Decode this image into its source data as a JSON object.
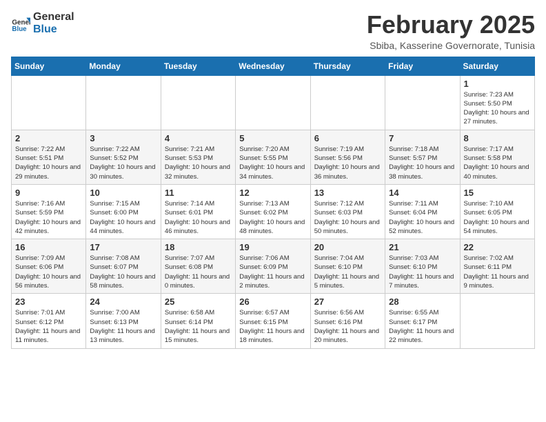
{
  "header": {
    "logo_general": "General",
    "logo_blue": "Blue",
    "month_year": "February 2025",
    "location": "Sbiba, Kasserine Governorate, Tunisia"
  },
  "days_of_week": [
    "Sunday",
    "Monday",
    "Tuesday",
    "Wednesday",
    "Thursday",
    "Friday",
    "Saturday"
  ],
  "weeks": [
    [
      {
        "day": "",
        "info": ""
      },
      {
        "day": "",
        "info": ""
      },
      {
        "day": "",
        "info": ""
      },
      {
        "day": "",
        "info": ""
      },
      {
        "day": "",
        "info": ""
      },
      {
        "day": "",
        "info": ""
      },
      {
        "day": "1",
        "info": "Sunrise: 7:23 AM\nSunset: 5:50 PM\nDaylight: 10 hours and 27 minutes."
      }
    ],
    [
      {
        "day": "2",
        "info": "Sunrise: 7:22 AM\nSunset: 5:51 PM\nDaylight: 10 hours and 29 minutes."
      },
      {
        "day": "3",
        "info": "Sunrise: 7:22 AM\nSunset: 5:52 PM\nDaylight: 10 hours and 30 minutes."
      },
      {
        "day": "4",
        "info": "Sunrise: 7:21 AM\nSunset: 5:53 PM\nDaylight: 10 hours and 32 minutes."
      },
      {
        "day": "5",
        "info": "Sunrise: 7:20 AM\nSunset: 5:55 PM\nDaylight: 10 hours and 34 minutes."
      },
      {
        "day": "6",
        "info": "Sunrise: 7:19 AM\nSunset: 5:56 PM\nDaylight: 10 hours and 36 minutes."
      },
      {
        "day": "7",
        "info": "Sunrise: 7:18 AM\nSunset: 5:57 PM\nDaylight: 10 hours and 38 minutes."
      },
      {
        "day": "8",
        "info": "Sunrise: 7:17 AM\nSunset: 5:58 PM\nDaylight: 10 hours and 40 minutes."
      }
    ],
    [
      {
        "day": "9",
        "info": "Sunrise: 7:16 AM\nSunset: 5:59 PM\nDaylight: 10 hours and 42 minutes."
      },
      {
        "day": "10",
        "info": "Sunrise: 7:15 AM\nSunset: 6:00 PM\nDaylight: 10 hours and 44 minutes."
      },
      {
        "day": "11",
        "info": "Sunrise: 7:14 AM\nSunset: 6:01 PM\nDaylight: 10 hours and 46 minutes."
      },
      {
        "day": "12",
        "info": "Sunrise: 7:13 AM\nSunset: 6:02 PM\nDaylight: 10 hours and 48 minutes."
      },
      {
        "day": "13",
        "info": "Sunrise: 7:12 AM\nSunset: 6:03 PM\nDaylight: 10 hours and 50 minutes."
      },
      {
        "day": "14",
        "info": "Sunrise: 7:11 AM\nSunset: 6:04 PM\nDaylight: 10 hours and 52 minutes."
      },
      {
        "day": "15",
        "info": "Sunrise: 7:10 AM\nSunset: 6:05 PM\nDaylight: 10 hours and 54 minutes."
      }
    ],
    [
      {
        "day": "16",
        "info": "Sunrise: 7:09 AM\nSunset: 6:06 PM\nDaylight: 10 hours and 56 minutes."
      },
      {
        "day": "17",
        "info": "Sunrise: 7:08 AM\nSunset: 6:07 PM\nDaylight: 10 hours and 58 minutes."
      },
      {
        "day": "18",
        "info": "Sunrise: 7:07 AM\nSunset: 6:08 PM\nDaylight: 11 hours and 0 minutes."
      },
      {
        "day": "19",
        "info": "Sunrise: 7:06 AM\nSunset: 6:09 PM\nDaylight: 11 hours and 2 minutes."
      },
      {
        "day": "20",
        "info": "Sunrise: 7:04 AM\nSunset: 6:10 PM\nDaylight: 11 hours and 5 minutes."
      },
      {
        "day": "21",
        "info": "Sunrise: 7:03 AM\nSunset: 6:10 PM\nDaylight: 11 hours and 7 minutes."
      },
      {
        "day": "22",
        "info": "Sunrise: 7:02 AM\nSunset: 6:11 PM\nDaylight: 11 hours and 9 minutes."
      }
    ],
    [
      {
        "day": "23",
        "info": "Sunrise: 7:01 AM\nSunset: 6:12 PM\nDaylight: 11 hours and 11 minutes."
      },
      {
        "day": "24",
        "info": "Sunrise: 7:00 AM\nSunset: 6:13 PM\nDaylight: 11 hours and 13 minutes."
      },
      {
        "day": "25",
        "info": "Sunrise: 6:58 AM\nSunset: 6:14 PM\nDaylight: 11 hours and 15 minutes."
      },
      {
        "day": "26",
        "info": "Sunrise: 6:57 AM\nSunset: 6:15 PM\nDaylight: 11 hours and 18 minutes."
      },
      {
        "day": "27",
        "info": "Sunrise: 6:56 AM\nSunset: 6:16 PM\nDaylight: 11 hours and 20 minutes."
      },
      {
        "day": "28",
        "info": "Sunrise: 6:55 AM\nSunset: 6:17 PM\nDaylight: 11 hours and 22 minutes."
      },
      {
        "day": "",
        "info": ""
      }
    ]
  ]
}
